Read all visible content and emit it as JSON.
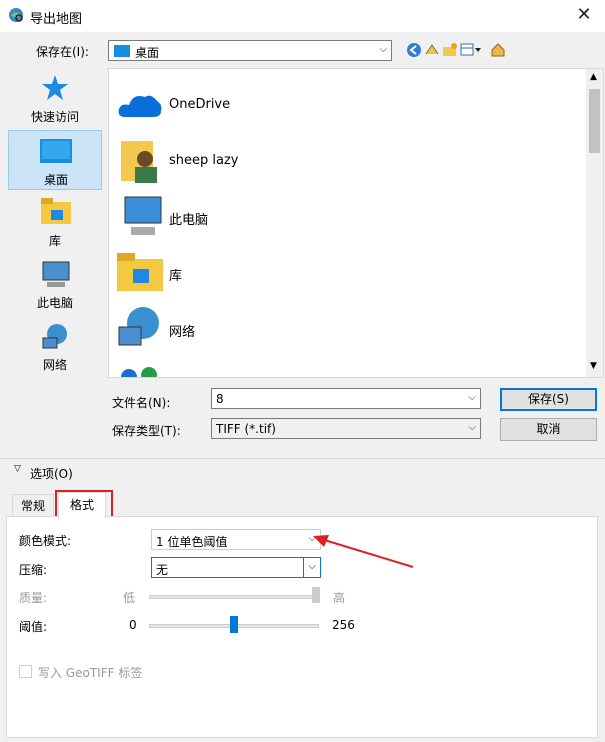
{
  "window": {
    "title": "导出地图",
    "close": "✕"
  },
  "savein": {
    "label": "保存在(I):",
    "value": "桌面"
  },
  "places": [
    {
      "label": "快速访问",
      "icon": "star-icon"
    },
    {
      "label": "桌面",
      "icon": "desktop-icon"
    },
    {
      "label": "库",
      "icon": "library-icon"
    },
    {
      "label": "此电脑",
      "icon": "computer-icon"
    },
    {
      "label": "网络",
      "icon": "network-icon"
    }
  ],
  "files": [
    {
      "name": "OneDrive",
      "icon": "onedrive-icon"
    },
    {
      "name": "sheep lazy",
      "icon": "user-folder-icon"
    },
    {
      "name": "此电脑",
      "icon": "computer-icon"
    },
    {
      "name": "库",
      "icon": "library-icon"
    },
    {
      "name": "网络",
      "icon": "network-icon"
    }
  ],
  "filename": {
    "label": "文件名(N):",
    "value": "8"
  },
  "filetype": {
    "label": "保存类型(T):",
    "value": "TIFF (*.tif)"
  },
  "buttons": {
    "save": "保存(S)",
    "cancel": "取消"
  },
  "options": {
    "label": "选项(O)"
  },
  "tabs": [
    {
      "label": "常规"
    },
    {
      "label": "格式"
    }
  ],
  "format": {
    "color_mode_label": "颜色模式:",
    "color_mode_value": "1 位单色阈值",
    "compression_label": "压缩:",
    "compression_value": "无",
    "quality_label": "质量:",
    "quality_low": "低",
    "quality_high": "高",
    "threshold_label": "阈值:",
    "threshold_min": "0",
    "threshold_max": "256",
    "threshold_fraction": 0.5,
    "geotiff_label": "写入 GeoTIFF 标签"
  },
  "colors": {
    "accent": "#0078d7",
    "highlight_red": "#e02020"
  }
}
